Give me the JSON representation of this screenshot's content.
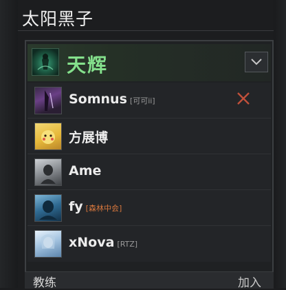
{
  "window": {
    "title": "太阳黑子"
  },
  "team": {
    "name": "天辉",
    "emblem_icon": "team-emblem-icon",
    "collapse_icon": "chevron-down-icon",
    "accent": "#84e08c"
  },
  "players": [
    {
      "name": "Somnus",
      "tag": "[可可ii]",
      "tag_color": "grey",
      "kick_icon": "close-icon"
    },
    {
      "name": "方展博",
      "tag": "",
      "tag_color": "grey"
    },
    {
      "name": "Ame",
      "tag": "",
      "tag_color": "grey"
    },
    {
      "name": "fy",
      "tag": "[森林中会]",
      "tag_color": "orange"
    },
    {
      "name": "xNova",
      "tag": "[RTZ]",
      "tag_color": "grey"
    }
  ],
  "footer": {
    "coach_label": "教练",
    "join_label": "加入"
  },
  "colors": {
    "kick": "#c0503b",
    "tag_orange": "#d9783d"
  }
}
